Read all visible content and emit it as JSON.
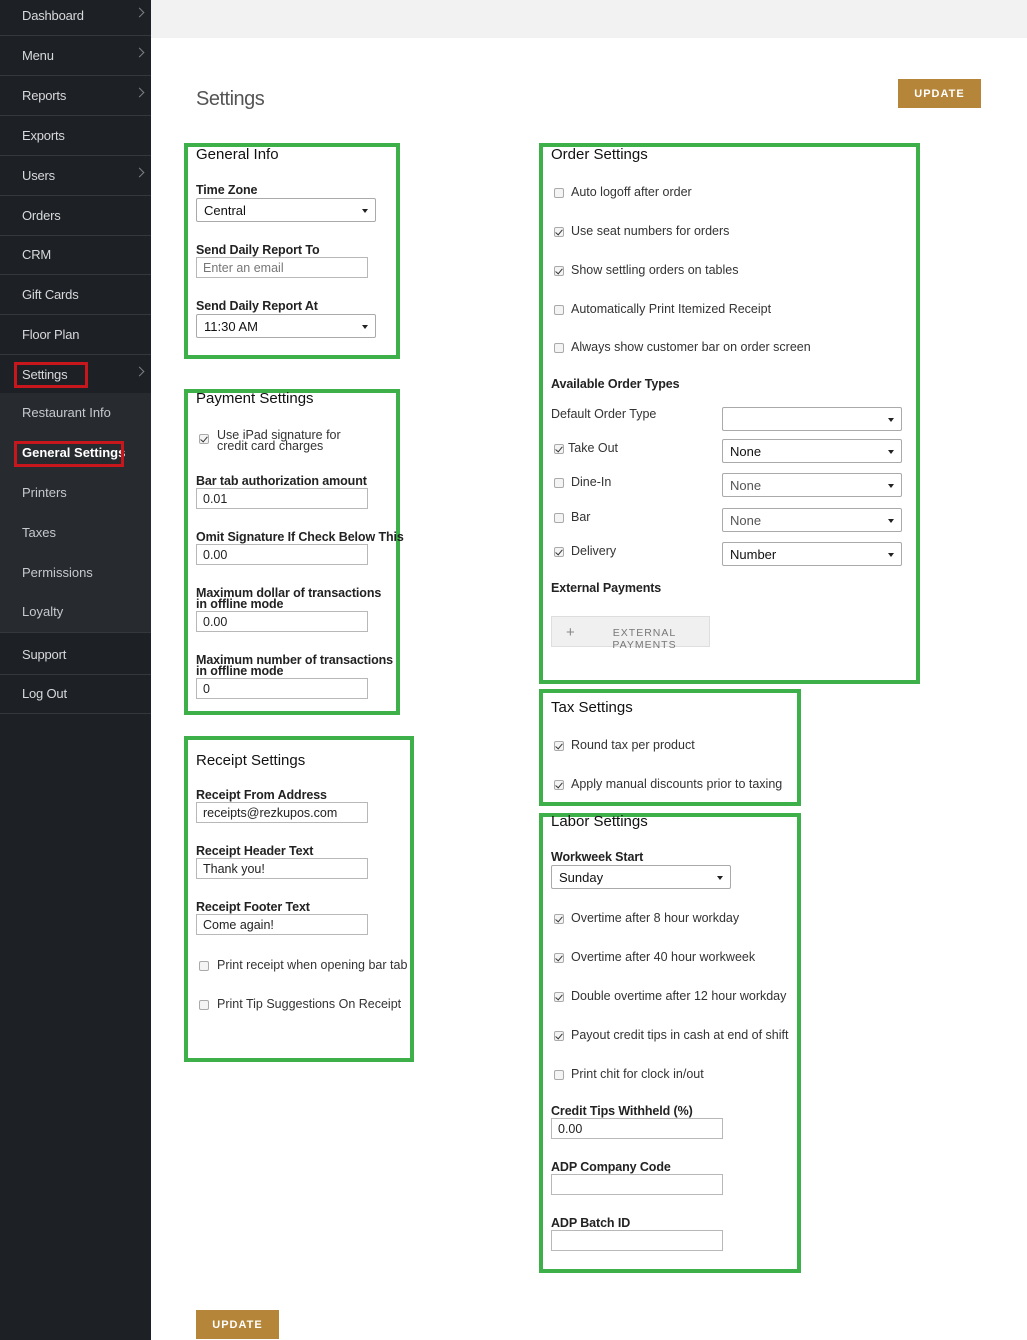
{
  "sidebar": {
    "items": [
      {
        "label": "Dashboard"
      },
      {
        "label": "Menu"
      },
      {
        "label": "Reports"
      },
      {
        "label": "Exports"
      },
      {
        "label": "Users"
      },
      {
        "label": "Orders"
      },
      {
        "label": "CRM"
      },
      {
        "label": "Gift Cards"
      },
      {
        "label": "Floor Plan"
      },
      {
        "label": "Settings"
      }
    ],
    "sub_items": [
      {
        "label": "Restaurant Info"
      },
      {
        "label": "General Settings"
      },
      {
        "label": "Printers"
      },
      {
        "label": "Taxes"
      },
      {
        "label": "Permissions"
      },
      {
        "label": "Loyalty"
      }
    ],
    "bottom_items": [
      {
        "label": "Support"
      },
      {
        "label": "Log Out"
      }
    ]
  },
  "page": {
    "title": "Settings",
    "update_label": "UPDATE"
  },
  "general_info": {
    "title": "General Info",
    "time_zone_label": "Time Zone",
    "time_zone_value": "Central",
    "daily_report_to_label": "Send Daily Report To",
    "daily_report_to_placeholder": "Enter an email",
    "daily_report_at_label": "Send Daily Report At",
    "daily_report_at_value": "11:30 AM"
  },
  "payment_settings": {
    "title": "Payment Settings",
    "ipad_signature_line1": "Use iPad signature for",
    "ipad_signature_line2": "credit card charges",
    "bar_tab_label": "Bar tab authorization amount",
    "bar_tab_value": "0.01",
    "omit_sig_label": "Omit Signature If Check Below This",
    "omit_sig_value": "0.00",
    "max_dollar_line1": "Maximum dollar of transactions",
    "max_dollar_line2": "in offline mode",
    "max_dollar_value": "0.00",
    "max_number_line1": "Maximum number of transactions",
    "max_number_line2": "in offline mode",
    "max_number_value": "0"
  },
  "receipt_settings": {
    "title": "Receipt Settings",
    "from_label": "Receipt From Address",
    "from_value": "receipts@rezkupos.com",
    "header_label": "Receipt Header Text",
    "header_value": "Thank you!",
    "footer_label": "Receipt Footer Text",
    "footer_value": "Come again!",
    "print_bar_tab": "Print receipt when opening bar tab",
    "print_tip": "Print Tip Suggestions On Receipt"
  },
  "order_settings": {
    "title": "Order Settings",
    "auto_logoff": "Auto logoff after order",
    "seat_numbers": "Use seat numbers for orders",
    "settling_orders": "Show settling orders on tables",
    "auto_print": "Automatically Print Itemized Receipt",
    "customer_bar": "Always show customer bar on order screen",
    "available_types_heading": "Available Order Types",
    "default_type_label": "Default Order Type",
    "default_type_value": "",
    "take_out_label": "Take Out",
    "take_out_value": "None",
    "dine_in_label": "Dine-In",
    "dine_in_value": "None",
    "bar_label": "Bar",
    "bar_value": "None",
    "delivery_label": "Delivery",
    "delivery_value": "Number",
    "external_heading": "External Payments",
    "external_button": "EXTERNAL PAYMENTS"
  },
  "tax_settings": {
    "title": "Tax Settings",
    "round_tax": "Round tax per product",
    "manual_discounts": "Apply manual discounts prior to taxing"
  },
  "labor_settings": {
    "title": "Labor Settings",
    "workweek_label": "Workweek Start",
    "workweek_value": "Sunday",
    "ot_8": "Overtime after 8 hour workday",
    "ot_40": "Overtime after 40 hour workweek",
    "double_ot": "Double overtime after 12 hour workday",
    "payout_tips": "Payout credit tips in cash at end of shift",
    "print_chit": "Print chit for clock in/out",
    "tips_withheld_label": "Credit Tips Withheld (%)",
    "tips_withheld_value": "0.00",
    "adp_company_label": "ADP Company Code",
    "adp_company_value": "",
    "adp_batch_label": "ADP Batch ID",
    "adp_batch_value": ""
  },
  "colors": {
    "sidebar_bg": "#1d2024",
    "accent_button": "#b5853a",
    "highlight_green": "#3db04a",
    "highlight_red": "#c8161d"
  }
}
